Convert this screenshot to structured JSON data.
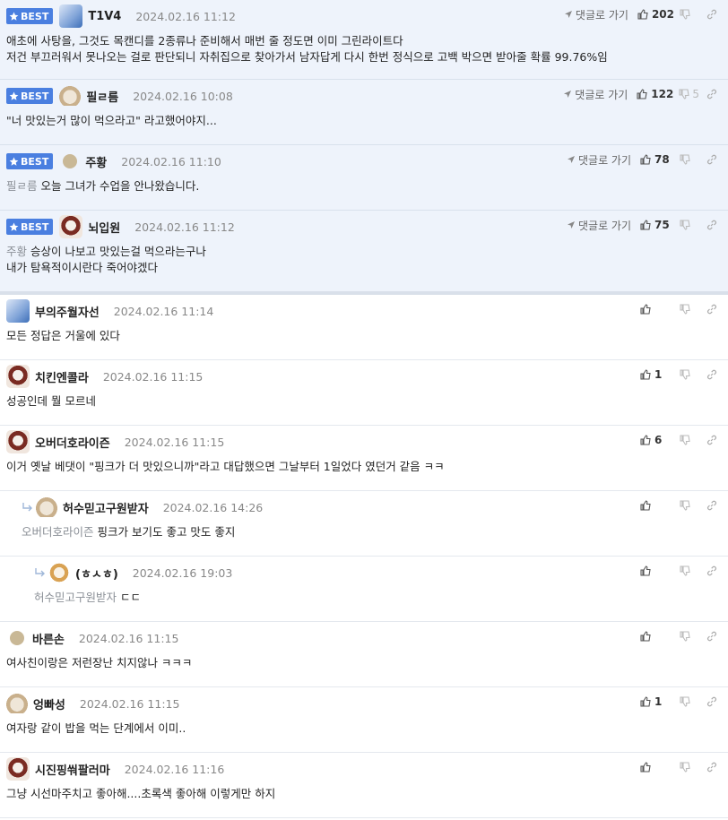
{
  "best_label": "BEST",
  "reply_link_label": "댓글로 가기",
  "icons": {
    "star": "star-icon",
    "reply": "reply-arrow-icon",
    "thumbs_up": "thumbs-up-icon",
    "thumbs_down": "thumbs-down-icon",
    "share": "link-icon"
  },
  "colors": {
    "best_bg": "#eef3fb",
    "badge": "#4a7fe0"
  },
  "comments": [
    {
      "best": true,
      "nick": "T1V4",
      "date": "2024.02.16 11:12",
      "likes": "202",
      "dislikes": "",
      "mention": "",
      "lines": [
        "애초에 사탕을, 그것도 목캔디를 2종류나 준비해서 매번 줄 정도면 이미 그린라이트다",
        "저건 부끄러워서 못나오는 걸로 판단되니 자취집으로 찾아가서 남자답게 다시 한번 정식으로 고백 박으면 받아줄 확률 99.76%임"
      ]
    },
    {
      "best": true,
      "nick": "필ㄹ름",
      "date": "2024.02.16 10:08",
      "likes": "122",
      "dislikes": "5",
      "mention": "",
      "lines": [
        "\"너 맛있는거 많이 먹으라고\" 라고했어야지..."
      ]
    },
    {
      "best": true,
      "nick": "주황",
      "date": "2024.02.16 11:10",
      "likes": "78",
      "dislikes": "",
      "mention": "필ㄹ름",
      "lines": [
        "오늘 그녀가 수업을 안나왔습니다."
      ]
    },
    {
      "best": true,
      "nick": "뇌입원",
      "date": "2024.02.16 11:12",
      "likes": "75",
      "dislikes": "",
      "mention": "주황",
      "lines": [
        "승상이 나보고 맛있는걸 먹으라는구나",
        "내가 탐욕적이시란다 죽어야겠다"
      ]
    },
    {
      "best": false,
      "nick": "부의주월자선",
      "date": "2024.02.16 11:14",
      "likes": "",
      "dislikes": "",
      "mention": "",
      "lines": [
        "모든 정답은 거울에 있다"
      ]
    },
    {
      "best": false,
      "nick": "치킨엔콜라",
      "date": "2024.02.16 11:15",
      "likes": "1",
      "dislikes": "",
      "mention": "",
      "lines": [
        "성공인데 뭘 모르네"
      ]
    },
    {
      "best": false,
      "nick": "오버더호라이즌",
      "date": "2024.02.16 11:15",
      "likes": "6",
      "dislikes": "",
      "mention": "",
      "lines": [
        "이거 옛날 베댓이 \"핑크가 더 맛있으니까\"라고 대답했으면 그날부터 1일었다 였던거 같음 ㅋㅋ"
      ]
    },
    {
      "best": false,
      "nick": "허수믿고구원받자",
      "date": "2024.02.16 14:26",
      "likes": "",
      "dislikes": "",
      "mention": "오버더호라이즌",
      "lines": [
        "핑크가 보기도 좋고 맛도 좋지"
      ]
    },
    {
      "best": false,
      "nick": "(ㅎㅅㅎ)",
      "date": "2024.02.16 19:03",
      "likes": "",
      "dislikes": "",
      "mention": "허수믿고구원받자",
      "lines": [
        "ㄷㄷ"
      ]
    },
    {
      "best": false,
      "nick": "바른손",
      "date": "2024.02.16 11:15",
      "likes": "",
      "dislikes": "",
      "mention": "",
      "lines": [
        "여사친이랑은 저런장난 치지않나 ㅋㅋㅋ"
      ]
    },
    {
      "best": false,
      "nick": "엉빠성",
      "date": "2024.02.16 11:15",
      "likes": "1",
      "dislikes": "",
      "mention": "",
      "lines": [
        "여자랑 같이 밥을 먹는 단계에서 이미.."
      ]
    },
    {
      "best": false,
      "nick": "시진핑쒀팔러마",
      "date": "2024.02.16 11:16",
      "likes": "",
      "dislikes": "",
      "mention": "",
      "lines": [
        "그냥 시선마주치고 좋아해....초록색 좋아해 이렇게만 하지"
      ]
    }
  ]
}
